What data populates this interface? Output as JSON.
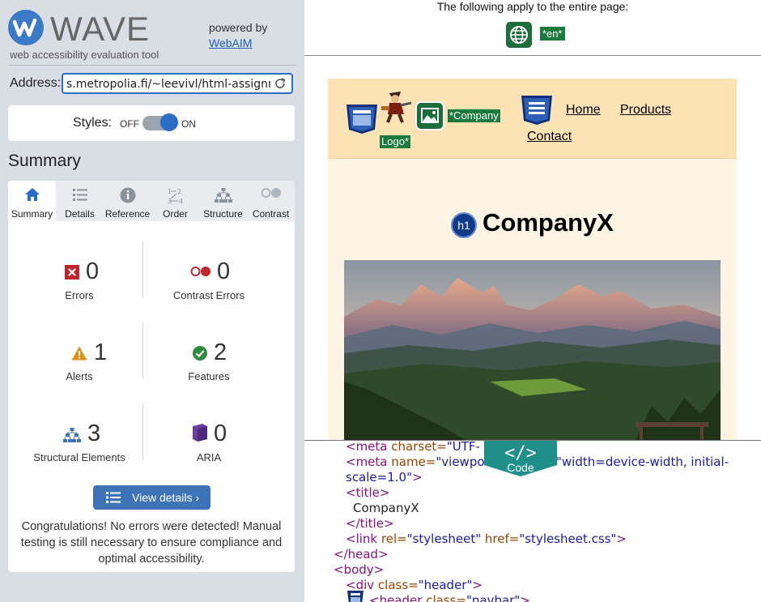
{
  "brand": {
    "name": "WAVE",
    "tagline": "web accessibility evaluation tool",
    "powered_by": "powered by",
    "powered_by_link": "WebAIM"
  },
  "address": {
    "label": "Address:",
    "value": "s.metropolia.fi/~leevivl/html-assignment/"
  },
  "styles": {
    "label": "Styles:",
    "off": "OFF",
    "on": "ON",
    "state": "on"
  },
  "summary": {
    "title": "Summary",
    "tabs": [
      {
        "label": "Summary",
        "icon": "home-icon",
        "active": true
      },
      {
        "label": "Details",
        "icon": "list-icon"
      },
      {
        "label": "Reference",
        "icon": "info-icon"
      },
      {
        "label": "Order",
        "icon": "order-icon"
      },
      {
        "label": "Structure",
        "icon": "structure-icon"
      },
      {
        "label": "Contrast",
        "icon": "contrast-icon"
      }
    ],
    "stats": {
      "errors": {
        "value": "0",
        "label": "Errors"
      },
      "contrast_errors": {
        "value": "0",
        "label": "Contrast Errors"
      },
      "alerts": {
        "value": "1",
        "label": "Alerts"
      },
      "features": {
        "value": "2",
        "label": "Features"
      },
      "structural": {
        "value": "3",
        "label": "Structural Elements"
      },
      "aria": {
        "value": "0",
        "label": "ARIA"
      }
    },
    "view_details": "View details ›",
    "congrats": "Congratulations! No errors were detected! Manual testing is still necessary to ensure compliance and optimal accessibility."
  },
  "preview": {
    "page_note": "The following apply to the entire page:",
    "lang_badge": "*en*",
    "company_badge": "*Company",
    "logo_badge": "Logo*",
    "nav": [
      "Home",
      "Products",
      "Contact"
    ],
    "heading": "CompanyX",
    "h1_badge": "h1"
  },
  "code": {
    "tab_label": "Code",
    "tab_symbol": "</>",
    "lines": {
      "l1_tag": "<meta",
      "l1_attr": "charset=",
      "l1_val": "\"UTF-",
      "l2_tag": "<meta",
      "l2_attr": "name=",
      "l2_val": "\"viewpo",
      "l2_val2": "\"width=device-width, initial-",
      "l3_val": "scale=1.0\"",
      "l3_end": ">",
      "l4": "<title>",
      "l5": "CompanyX",
      "l6": "</title>",
      "l7_tag": "<link",
      "l7_attr1": "rel=",
      "l7_val1": "\"stylesheet\"",
      "l7_attr2": "href=",
      "l7_val2": "\"stylesheet.css\"",
      "l7_end": ">",
      "l8": "</head>",
      "l9": "<body>",
      "l10_tag": "<div",
      "l10_attr": "class=",
      "l10_val": "\"header\"",
      "l10_end": ">",
      "l11_tag": "<header",
      "l11_attr": "class=",
      "l11_val": "\"navbar\"",
      "l11_end": ">"
    }
  },
  "colors": {
    "accent": "#2b6cc4",
    "sidebar_bg": "#d9dde4",
    "error": "#c0262d",
    "alert": "#e09216",
    "feature": "#2f8a3f",
    "aria": "#6a3fa0",
    "wave_green": "#1b7a3e",
    "header_bg": "#fde2b5"
  }
}
